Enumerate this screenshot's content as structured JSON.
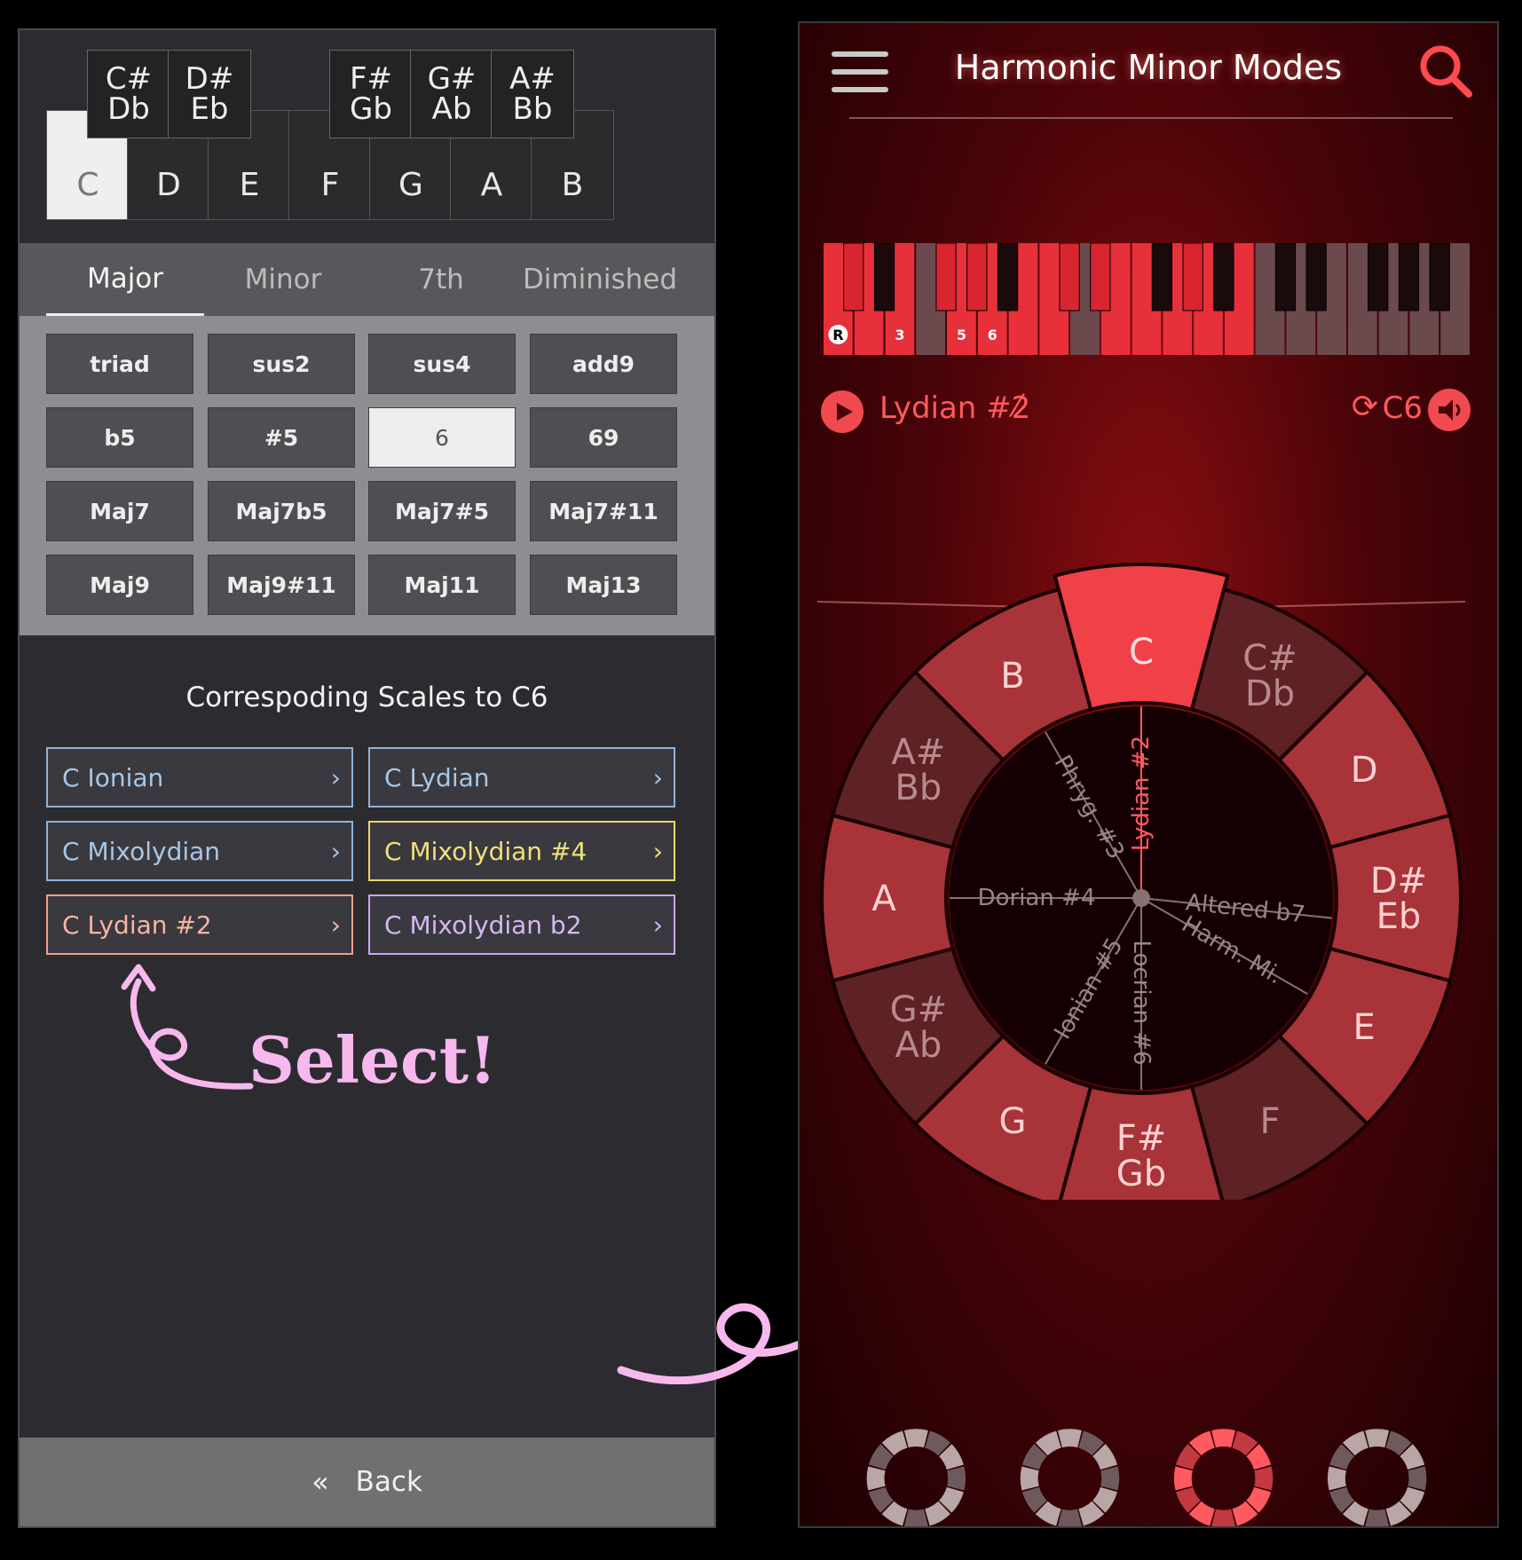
{
  "left": {
    "white_keys": [
      "C",
      "D",
      "E",
      "F",
      "G",
      "A",
      "B"
    ],
    "selected_key": "C",
    "black_keys": [
      "C#\nDb",
      "D#\nEb",
      "F#\nGb",
      "G#\nAb",
      "A#\nBb"
    ],
    "tabs": [
      "Major",
      "Minor",
      "7th",
      "Diminished"
    ],
    "active_tab": "Major",
    "chord_buttons": [
      [
        "triad",
        "sus2",
        "sus4",
        "add9"
      ],
      [
        "b5",
        "#5",
        "6",
        "69"
      ],
      [
        "Maj7",
        "Maj7b5",
        "Maj7#5",
        "Maj7#11"
      ],
      [
        "Maj9",
        "Maj9#11",
        "Maj11",
        "Maj13"
      ]
    ],
    "selected_chord": "6",
    "scales_title": "Correspoding Scales to C6",
    "scales": [
      {
        "label": "C Ionian",
        "color": "#8fb3d9"
      },
      {
        "label": "C Lydian",
        "color": "#8fb3d9"
      },
      {
        "label": "C Mixolydian",
        "color": "#8fb3d9"
      },
      {
        "label": "C Mixolydian #4",
        "color": "#e8d86a"
      },
      {
        "label": "C Lydian #2",
        "color": "#f0a08a"
      },
      {
        "label": "C Mixolydian b2",
        "color": "#c8a6ec"
      }
    ],
    "chevron": "›",
    "annotation": "Select!",
    "back_icon": "«",
    "back_label": "Back"
  },
  "right": {
    "title": "Harmonic Minor Modes",
    "piano_labels": [
      "R",
      "3",
      "5",
      "6"
    ],
    "mode_name": "Lydian #2",
    "pencil": "⁄",
    "loop_icon": "⟳",
    "chord_name": "C6",
    "wheel_notes": [
      "C",
      "C#\nDb",
      "D",
      "D#\nEb",
      "E",
      "F",
      "F#\nGb",
      "G",
      "G#\nAb",
      "A",
      "A#\nBb",
      "B"
    ],
    "highlighted_note": "C",
    "mode_labels": [
      "Lydian #2",
      "Altered b7",
      "Harm. Mi.",
      "Locrian #6",
      "Ionian #5",
      "Dorian #4",
      "Phryg. #3"
    ],
    "accent": "#ff4a4f"
  }
}
